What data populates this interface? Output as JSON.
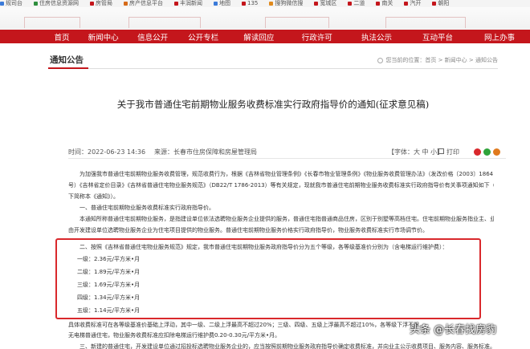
{
  "bookmarks": [
    {
      "label": "规司台",
      "color": "#3b7bd9"
    },
    {
      "label": "住房信息资源网",
      "color": "#2f8f3e"
    },
    {
      "label": "房管局",
      "color": "#c4161c"
    },
    {
      "label": "房产信息平台",
      "color": "#d66b1a"
    },
    {
      "label": "丰润新闻",
      "color": "#c4161c"
    },
    {
      "label": "地图",
      "color": "#3b7bd9"
    },
    {
      "label": "135",
      "color": "#c4161c"
    },
    {
      "label": "搜狗微信搜",
      "color": "#e08a1e"
    },
    {
      "label": "宽城区",
      "color": "#c4161c"
    },
    {
      "label": "二道",
      "color": "#c4161c"
    },
    {
      "label": "南关",
      "color": "#c4161c"
    },
    {
      "label": "汽开",
      "color": "#c4161c"
    },
    {
      "label": "朝阳",
      "color": "#c4161c"
    }
  ],
  "nav": [
    "首页",
    "新闻中心",
    "信息公开",
    "公开专栏",
    "解读回应",
    "行政许可",
    "执法公示",
    "互动平台",
    "网上办事"
  ],
  "section": {
    "title": "通知公告",
    "breadcrumb": "您当前的位置：首页 > 新闻中心 > 通知公告"
  },
  "article": {
    "title": "关于我市普通住宅前期物业服务收费标准实行政府指导价的通知(征求意见稿)",
    "time": "时间：2022-06-23 14:36",
    "source": "来源：长春市住房保障和房屋管理局",
    "fontsize": "【字体：大 中 小】",
    "print": "打印"
  },
  "body": [
    "为加强我市普通住宅前期物业服务收费管理，规范收费行为，根据《吉林省物业管理条例》《长春市物业管理条例》《物业服务收费管理办法》（发改价格〔2003〕1864",
    "号）《吉林省定价目录》《吉林省普通住宅物业服务规范》（DB22/T 1786-2013）等有关规定，现就我市普通住宅前期物业服务收费标准实行政府指导价有关事项通知如下（以",
    "下简称本《通知》）。",
    "一、普通住宅前期物业服务收费标准实行政府指导价。",
    "本通知所称普通住宅前期物业服务，是指建设单位依法选聘物业服务企业提供的服务，普通住宅指普通商品住房，区别于别墅等高档住宅。住宅前期物业服务指业主、业主大会选聘物业服务企业前，",
    "由开发建设单位选聘物业服务企业为住宅项目提供的物业服务。普通住宅前期物业服务价格实行政府指导价，物业服务收费标准实行市场调节价。",
    "二、按照《吉林省普通住宅物业服务规范》规定，我市普通住宅前期物业服务政府指导价分为五个等级，各等级基准价分别为（含电梯运行维护费）：",
    "具体收费标准可在各等级基准价基础上浮动，其中一级、二级上浮最高不超过20%；三级、四级、五级上浮最高不超过10%，各等级下浮不限。",
    "无电梯普通住宅，物业服务收费标准应扣除电梯运行维护费0.20-0.30元/平方米•月。",
    "三、新建的普通住宅，开发建设单位通过招投标选聘物业服务企业的，应当按照前期物业服务政府指导价确定收费标准，并向业主公示收费项目、服务内容、服务标准。"
  ],
  "tiers": [
    "一级：2.36元/平方米•月",
    "二级：1.89元/平方米•月",
    "三级：1.69元/平方米•月",
    "四级：1.34元/平方米•月",
    "五级：1.14元/平方米•月"
  ],
  "watermark": "头条 @长春找房豹"
}
